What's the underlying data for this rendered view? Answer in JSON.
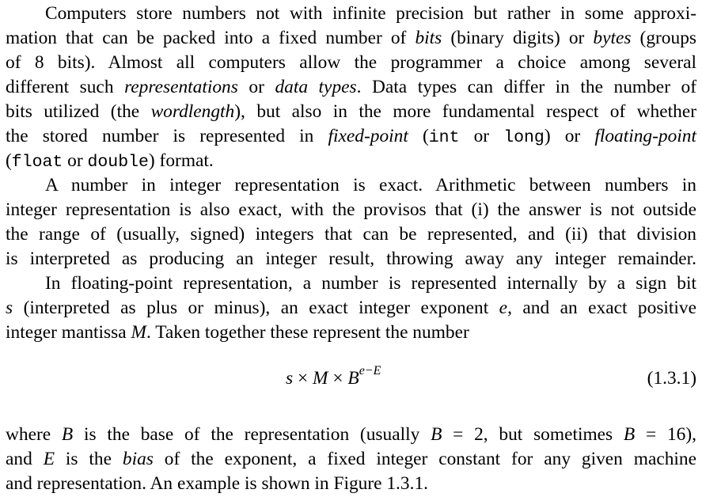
{
  "paragraph1": {
    "l1": [
      "Computers store numbers not with infinite precision but rather in some approxi-"
    ],
    "l2": [
      "mation that can be packed into a fixed number of ",
      "bits",
      " (binary digits) or ",
      "bytes",
      " (groups"
    ],
    "l3": [
      "of 8 bits).  Almost all computers allow the programmer a choice among several"
    ],
    "l4": [
      "different such ",
      "representations",
      " or ",
      "data types",
      ".  Data types can differ in the number of"
    ],
    "l5": [
      "bits utilized (the ",
      "wordlength",
      "), but also in the more fundamental respect of whether"
    ],
    "l6": [
      "the stored number is represented in ",
      "fixed-point",
      " (",
      "int",
      " or ",
      "long",
      ") or ",
      "floating-point"
    ],
    "l7": [
      "(",
      "float",
      " or ",
      "double",
      ") format."
    ]
  },
  "paragraph2": {
    "l1": "A number in integer representation is exact.  Arithmetic between numbers in",
    "l2": "integer representation is also exact, with the provisos that (i) the answer is not outside",
    "l3": "the range of (usually, signed) integers that can be represented, and (ii) that division",
    "l4": "is interpreted as producing an integer result, throwing away any integer remainder."
  },
  "paragraph3": {
    "l1": "In floating-point representation, a number is represented internally by a sign bit",
    "l2": [
      "s",
      " (interpreted as plus or minus), an exact integer exponent ",
      "e",
      ", and an exact positive"
    ],
    "l3": [
      "integer mantissa ",
      "M",
      ".  Taken together these represent the number"
    ]
  },
  "equation": {
    "s": "s",
    "times1": " × ",
    "M": "M",
    "times2": " × ",
    "B": "B",
    "exponent": "e−E",
    "number": "(1.3.1)"
  },
  "paragraph4": {
    "l1": [
      "where ",
      "B",
      " is the base of the representation (usually ",
      "B",
      " = 2, but sometimes ",
      "B",
      " = 16),"
    ],
    "l2": [
      "and ",
      "E",
      " is the ",
      "bias",
      " of the exponent, a fixed integer constant for any given machine"
    ],
    "l3": "and representation.  An example is shown in Figure 1.3.1."
  }
}
